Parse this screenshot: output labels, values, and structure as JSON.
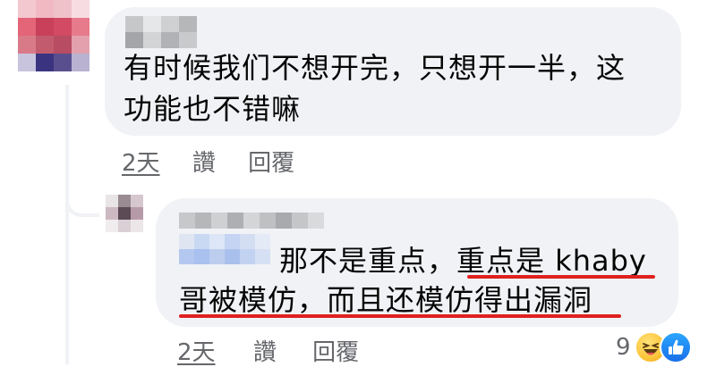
{
  "comments": [
    {
      "text_line1": "有时候我们不想开完，只想开一半，这",
      "text_line2": "功能也不错嘛",
      "time": "2天",
      "like": "讚",
      "reply": "回覆"
    },
    {
      "text_line1": "那不是重点，重点是 khaby",
      "text_line2": "哥被模仿，而且还模仿得出漏洞",
      "time": "2天",
      "like": "讚",
      "reply": "回覆",
      "reaction_count": "9"
    }
  ],
  "colors": {
    "bubble": "#f0f2f5",
    "meta_text": "#65676b",
    "highlight_underline": "#e02020"
  },
  "icons": [
    "haha-reaction-icon",
    "like-reaction-icon"
  ]
}
